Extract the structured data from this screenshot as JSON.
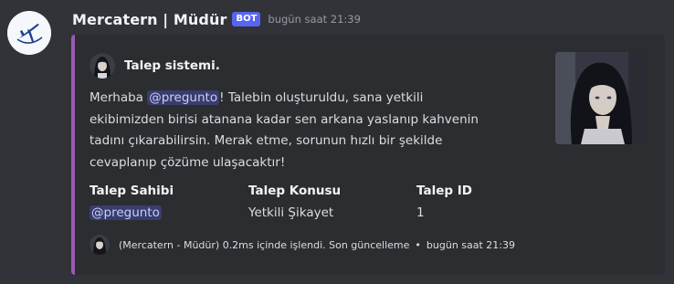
{
  "message": {
    "username": "Mercatern | Müdür",
    "bot_tag": "BOT",
    "timestamp": "bugün saat 21:39",
    "avatar_icon": "airplane-logo-icon"
  },
  "embed": {
    "accent_color": "#9b59b6",
    "author": {
      "name": "Talep sistemi.",
      "icon": "anime-character-avatar"
    },
    "description": {
      "before_mention": "Merhaba ",
      "mention": "@pregunto",
      "after_mention": "! Talebin oluşturuldu, sana yetkili ekibimizden birisi atanana kadar sen arkana yaslanıp kahvenin tadını çıkarabilirsin. Merak etme, sorunun hızlı bir şekilde cevaplanıp çözüme ulaşacaktır!"
    },
    "fields": [
      {
        "name": "Talep Sahibi",
        "value": "@pregunto"
      },
      {
        "name": "Talep Konusu",
        "value": "Yetkili Şikayet"
      },
      {
        "name": "Talep ID",
        "value": "1"
      }
    ],
    "footer": {
      "text": "(Mercatern - Müdür) 0.2ms içinde işlendi. Son güncelleme",
      "separator": "•",
      "timestamp": "bugün saat 21:39"
    }
  }
}
